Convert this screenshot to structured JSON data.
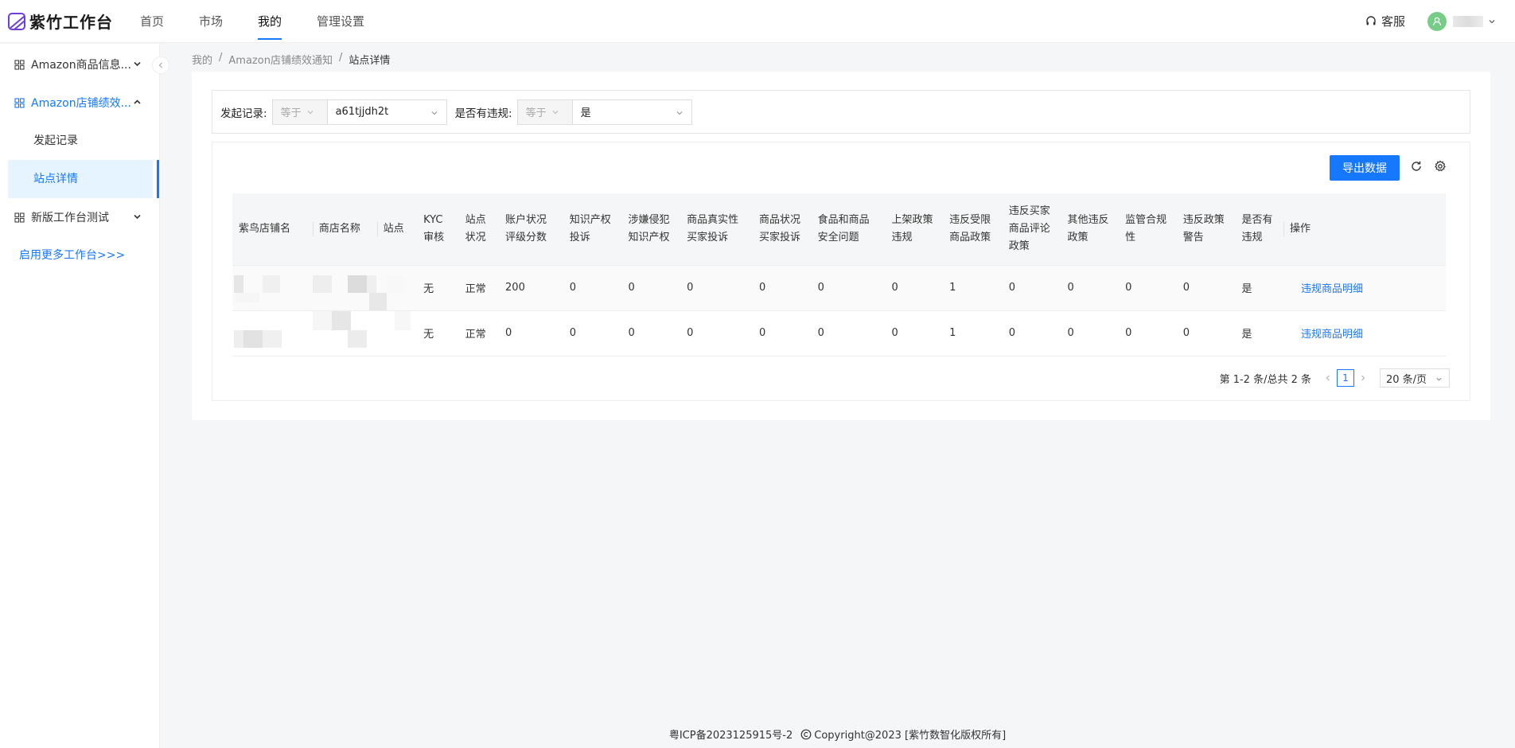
{
  "app": {
    "name": "紫竹工作台"
  },
  "nav": {
    "items": [
      "首页",
      "市场",
      "我的",
      "管理设置"
    ],
    "active": "我的"
  },
  "header": {
    "service_label": "客服"
  },
  "sidebar": {
    "items": [
      {
        "label": "Amazon商品信息..."
      },
      {
        "label": "Amazon店铺绩效..."
      },
      {
        "label": "新版工作台测试"
      }
    ],
    "sub_items": [
      "发起记录",
      "站点详情"
    ],
    "more_link": "启用更多工作台>>>"
  },
  "breadcrumb": [
    "我的",
    "/",
    "Amazon店铺绩效通知",
    "/",
    "站点详情"
  ],
  "filters": [
    {
      "label": "发起记录:",
      "operator": "等于",
      "value": "a61tjjdh2t"
    },
    {
      "label": "是否有违规:",
      "operator": "等于",
      "value": "是"
    }
  ],
  "toolbar": {
    "export_label": "导出数据"
  },
  "table": {
    "columns": [
      [
        "紫鸟店铺名"
      ],
      [
        "商店名称"
      ],
      [
        "站点"
      ],
      [
        "KYC",
        "审核"
      ],
      [
        "站点",
        "状况"
      ],
      [
        "账户状况",
        "评级分数"
      ],
      [
        "知识产权",
        "投诉"
      ],
      [
        "涉嫌侵犯",
        "知识产权"
      ],
      [
        "商品真实性",
        "买家投诉"
      ],
      [
        "商品状况",
        "买家投诉"
      ],
      [
        "食品和商品",
        "安全问题"
      ],
      [
        "上架政策",
        "违规"
      ],
      [
        "违反受限",
        "商品政策"
      ],
      [
        "违反买家",
        "商品评论",
        "政策"
      ],
      [
        "其他违反",
        "政策"
      ],
      [
        "监管合规",
        "性"
      ],
      [
        "违反政策",
        "警告"
      ],
      [
        "是否有",
        "违规"
      ],
      [
        "操作"
      ]
    ],
    "rows": [
      [
        "无",
        "正常",
        "200",
        "0",
        "0",
        "0",
        "0",
        "0",
        "0",
        "1",
        "0",
        "0",
        "0",
        "0",
        "是",
        "违规商品明细"
      ],
      [
        "无",
        "正常",
        "0",
        "0",
        "0",
        "0",
        "0",
        "0",
        "0",
        "1",
        "0",
        "0",
        "0",
        "0",
        "是",
        "违规商品明细"
      ]
    ]
  },
  "pagination": {
    "summary": "第 1-2 条/总共 2 条",
    "current_page": "1",
    "page_size": "20 条/页"
  },
  "footer": {
    "icp": "粤ICP备2023125915号-2",
    "copyright": "Copyright@2023 [紫竹数智化版权所有]"
  }
}
